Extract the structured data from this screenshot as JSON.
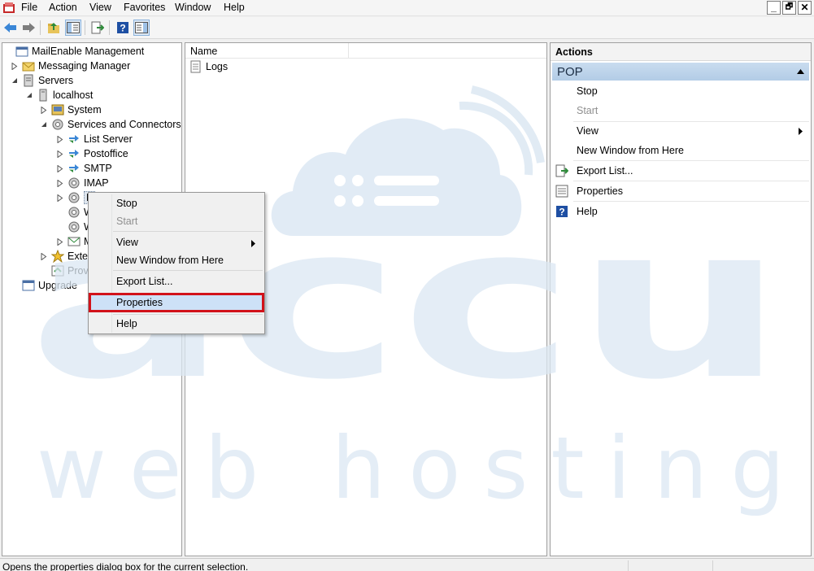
{
  "menubar": {
    "items": [
      "File",
      "Action",
      "View",
      "Favorites",
      "Window",
      "Help"
    ],
    "window_buttons": [
      "_",
      "🗗",
      "✕"
    ]
  },
  "toolbar": {
    "icons": [
      "back-icon",
      "forward-icon",
      "up-folder-icon",
      "show-hide-tree-icon",
      "export-list-icon",
      "help-icon",
      "show-hide-action-pane-icon"
    ]
  },
  "tree": {
    "items": [
      {
        "label": "MailEnable Management",
        "icon": "management-icon",
        "expander": "none"
      },
      {
        "label": "Messaging Manager",
        "icon": "envelope-icon",
        "expander": "collapsed"
      },
      {
        "label": "Servers",
        "icon": "servers-icon",
        "expander": "expanded"
      },
      {
        "label": "localhost",
        "icon": "server-icon",
        "expander": "expanded"
      },
      {
        "label": "System",
        "icon": "system-icon",
        "expander": "collapsed"
      },
      {
        "label": "Services and Connectors",
        "icon": "gear-icon",
        "expander": "expanded"
      },
      {
        "label": "List Server",
        "icon": "connector-icon",
        "expander": "collapsed"
      },
      {
        "label": "Postoffice",
        "icon": "connector-icon",
        "expander": "collapsed"
      },
      {
        "label": "SMTP",
        "icon": "connector-icon",
        "expander": "collapsed"
      },
      {
        "label": "IMAP",
        "icon": "gear-icon",
        "expander": "collapsed"
      },
      {
        "label": "P",
        "icon": "gear-icon",
        "expander": "collapsed"
      },
      {
        "label": "W",
        "icon": "gear-icon",
        "expander": "none"
      },
      {
        "label": "W",
        "icon": "gear-icon",
        "expander": "none"
      },
      {
        "label": "M",
        "icon": "mail-connector-icon",
        "expander": "collapsed"
      },
      {
        "label": "Exter",
        "icon": "extensions-icon",
        "expander": "collapsed"
      },
      {
        "label": "Prov",
        "icon": "provider-icon",
        "expander": "none"
      },
      {
        "label": "Upgrade",
        "icon": "upgrade-icon",
        "expander": "none"
      }
    ]
  },
  "center": {
    "column_header": "Name",
    "items": [
      {
        "label": "Logs",
        "icon": "log-icon"
      }
    ]
  },
  "actions": {
    "header": "Actions",
    "group_title": "POP",
    "items": {
      "stop": "Stop",
      "start": "Start",
      "view": "View",
      "new_window": "New Window from Here",
      "export_list": "Export List...",
      "properties": "Properties",
      "help": "Help"
    }
  },
  "context_menu": {
    "stop": "Stop",
    "start": "Start",
    "view": "View",
    "new_window": "New Window from Here",
    "export_list": "Export List...",
    "properties": "Properties",
    "help": "Help"
  },
  "watermark": {
    "line1": "accu",
    "line2": "web hosting"
  },
  "status": {
    "text": "Opens the properties dialog box for the current selection."
  },
  "colors": {
    "selection": "#cde1f7",
    "highlight_box": "#d2121a",
    "action_group": "#b3cce6",
    "watermark": "#dde9f4"
  }
}
